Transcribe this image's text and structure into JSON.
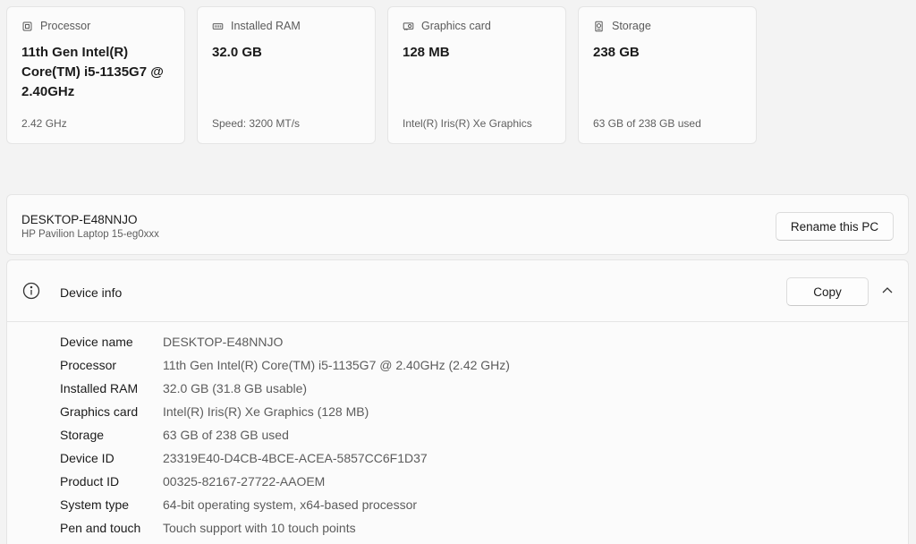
{
  "cards": [
    {
      "icon": "processor-icon",
      "title": "Processor",
      "value": "11th Gen Intel(R) Core(TM) i5-1135G7 @ 2.40GHz",
      "sub": "2.42 GHz"
    },
    {
      "icon": "ram-icon",
      "title": "Installed RAM",
      "value": "32.0 GB",
      "sub": "Speed: 3200 MT/s"
    },
    {
      "icon": "graphics-card-icon",
      "title": "Graphics card",
      "value": "128 MB",
      "sub": "Intel(R) Iris(R) Xe Graphics"
    },
    {
      "icon": "storage-icon",
      "title": "Storage",
      "value": "238 GB",
      "sub": "63 GB of 238 GB used"
    }
  ],
  "pc": {
    "name": "DESKTOP-E48NNJO",
    "model": "HP Pavilion Laptop 15-eg0xxx",
    "rename_label": "Rename this PC"
  },
  "device_info": {
    "title": "Device info",
    "copy_label": "Copy",
    "specs": [
      {
        "label": "Device name",
        "value": "DESKTOP-E48NNJO"
      },
      {
        "label": "Processor",
        "value": "11th Gen Intel(R) Core(TM) i5-1135G7 @ 2.40GHz (2.42 GHz)"
      },
      {
        "label": "Installed RAM",
        "value": "32.0 GB (31.8 GB usable)"
      },
      {
        "label": "Graphics card",
        "value": "Intel(R) Iris(R) Xe Graphics (128 MB)"
      },
      {
        "label": "Storage",
        "value": "63 GB of 238 GB used"
      },
      {
        "label": "Device ID",
        "value": "23319E40-D4CB-4BCE-ACEA-5857CC6F1D37"
      },
      {
        "label": "Product ID",
        "value": "00325-82167-27722-AAOEM"
      },
      {
        "label": "System type",
        "value": "64-bit operating system, x64-based processor"
      },
      {
        "label": "Pen and touch",
        "value": "Touch support with 10 touch points"
      }
    ]
  }
}
